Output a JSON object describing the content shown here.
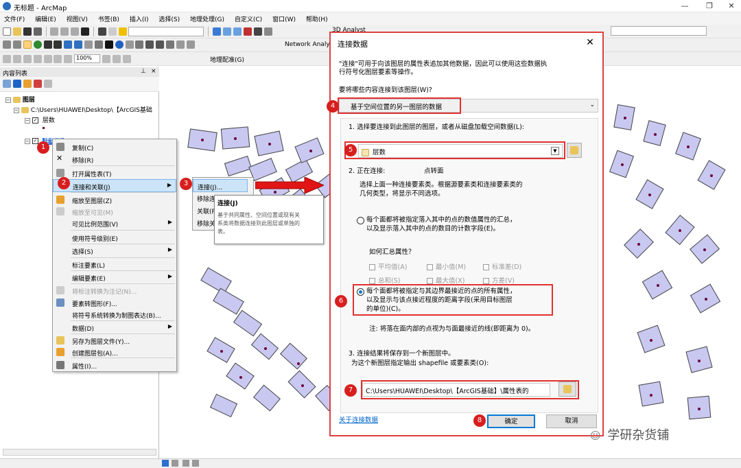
{
  "window": {
    "title": "无标题 - ArcMap"
  },
  "menu": [
    "文件(F)",
    "编辑(E)",
    "视图(V)",
    "书签(B)",
    "插入(I)",
    "选择(S)",
    "地理处理(G)",
    "自定义(C)",
    "窗口(W)",
    "帮助(H)"
  ],
  "toolbar": {
    "zoom_value": "100%",
    "network_label": "Network Analy",
    "geo_label": "地理配准(G)",
    "analyst_label": "3D Analyst"
  },
  "toc": {
    "title": "内容列表",
    "root": "图层",
    "folder": "C:\\Users\\HUAWEI\\Desktop\\【ArcGIS基础",
    "layer1": "层数",
    "layer2": "建筑面"
  },
  "context_menu": {
    "items": [
      {
        "label": "复制(C)",
        "disabled": false
      },
      {
        "label": "移除(R)",
        "disabled": false
      },
      {
        "label": "打开属性表(T)",
        "disabled": false
      },
      {
        "label": "连接和关联(J)",
        "disabled": false,
        "submenu": true
      },
      {
        "label": "缩放至图层(Z)",
        "disabled": false
      },
      {
        "label": "缩放至可见(M)",
        "disabled": true
      },
      {
        "label": "可见比例范围(V)",
        "disabled": false,
        "submenu": true
      },
      {
        "label": "使用符号级别(E)",
        "disabled": false
      },
      {
        "label": "选择(S)",
        "disabled": false,
        "submenu": true
      },
      {
        "label": "标注要素(L)",
        "disabled": false
      },
      {
        "label": "编辑要素(E)",
        "disabled": false,
        "submenu": true
      },
      {
        "label": "将标注转换为注记(N)...",
        "disabled": true
      },
      {
        "label": "要素转图形(F)...",
        "disabled": false
      },
      {
        "label": "将符号系统转换为制图表达(B)...",
        "disabled": false
      },
      {
        "label": "数据(D)",
        "disabled": false,
        "submenu": true
      },
      {
        "label": "另存为图层文件(Y)...",
        "disabled": false
      },
      {
        "label": "创建图层包(A)...",
        "disabled": false
      },
      {
        "label": "属性(I)...",
        "disabled": false
      }
    ]
  },
  "submenu": {
    "items": [
      "连接(J)...",
      "移除连接(R)",
      "关联(R)...",
      "移除关联(L)"
    ],
    "short_items": [
      "连接(J)...",
      "移除连接",
      "关联(R",
      "移除关"
    ]
  },
  "tooltip": {
    "title": "连接(J)",
    "body": "基于共同属性、空间位置或现有关系将数据连接到此图层或单独的表。",
    "line1": "基于共同属性、空间位置或现有关",
    "line2": "系类将数据连接到此图层或单独的",
    "line3": "表。"
  },
  "badges": [
    "1",
    "2",
    "3",
    "4",
    "5",
    "6",
    "7",
    "8"
  ],
  "dialog": {
    "title": "连接数据",
    "intro_line1": "\"连接\"可用于向该图层的属性表追加其他数据，因此可以使用这些数据执",
    "intro_line2": "行符号化图层要素等操作。",
    "question": "要将哪些内容连接到该图层(W)?",
    "join_type": "基于空间位置的另一图层的数据",
    "step1": "1. 选择要连接到此图层的图层，或者从磁盘加载空间数据(L):",
    "layer_choice": "层数",
    "step2_label": "2. 正在连接:",
    "step2_value": "点转面",
    "step2_desc1": "选择上面一种连接要素类。根据源要素类和连接要素类的",
    "step2_desc2": "几何类型，将显示不同选项。",
    "opt1_line1": "每个面都将被指定落入其中的点的数值属性的汇总，",
    "opt1_line2": "以及显示落入其中的点的数目的计数字段(E)。",
    "agg_question": "如何汇总属性？",
    "agg": [
      "平均值(A)",
      "最小值(M)",
      "标准差(D)",
      "总和(S)",
      "最大值(X)",
      "方差(V)"
    ],
    "opt2_line1": "每个面都将被指定与其边界最接近的点的所有属性，",
    "opt2_line2": "以及显示与该点接近程度的距离字段(采用目标图层",
    "opt2_line3": "的单位)(C)。",
    "note": "注: 将落在面内部的点视为与面最接近的线(即距离为 0)。",
    "step3": "3. 连接结果将保存到一个新图层中。",
    "step3_sub": "为这个新图层指定输出 shapefile 或要素类(O):",
    "output_path": "C:\\Users\\HUAWEI\\Desktop\\【ArcGIS基础】\\属性表的",
    "about_link": "关于连接数据",
    "ok": "确定",
    "cancel": "取消"
  },
  "watermark": "学研杂货铺",
  "colors": {
    "accent": "#d81e1e",
    "polygon": "#c8c8f0",
    "point": "#6b003a",
    "link": "#0066cc"
  }
}
